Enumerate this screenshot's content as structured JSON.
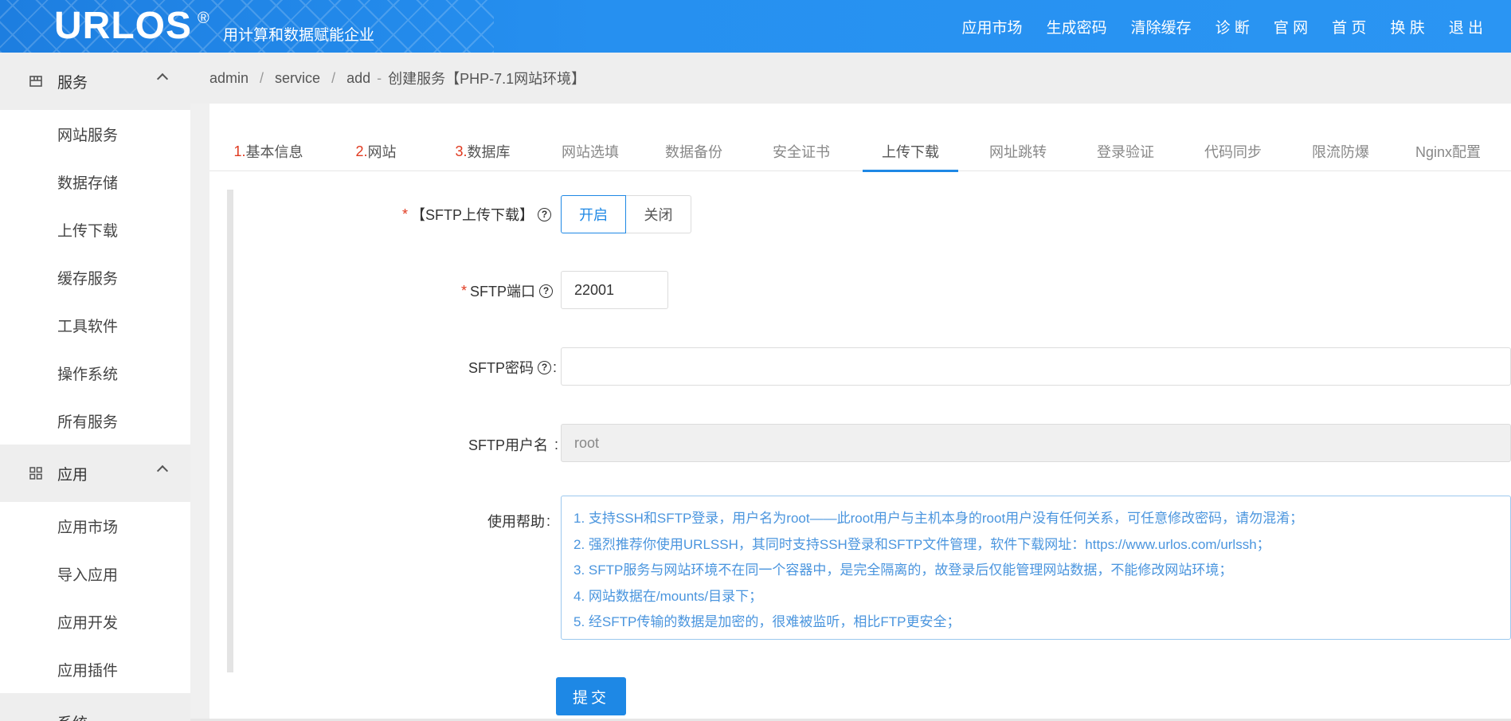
{
  "header": {
    "logo": "URLOS",
    "logo_mark": "®",
    "slogan": "用计算和数据赋能企业",
    "nav": [
      "应用市场",
      "生成密码",
      "清除缓存",
      "诊 断",
      "官 网",
      "首 页",
      "换 肤",
      "退 出"
    ]
  },
  "sidebar": {
    "groups": [
      {
        "label": "服务",
        "icon": "service-icon",
        "items": [
          "网站服务",
          "数据存储",
          "上传下载",
          "缓存服务",
          "工具软件",
          "操作系统",
          "所有服务"
        ]
      },
      {
        "label": "应用",
        "icon": "grid-icon",
        "items": [
          "应用市场",
          "导入应用",
          "应用开发",
          "应用插件"
        ]
      }
    ],
    "partial_group": "系统"
  },
  "breadcrumb": {
    "items": [
      "admin",
      "service",
      "add"
    ],
    "current": "创建服务【PHP-7.1网站环境】",
    "dash": "-"
  },
  "tabs": [
    {
      "num": "1.",
      "label": "基本信息"
    },
    {
      "num": "2.",
      "label": "网站"
    },
    {
      "num": "3.",
      "label": "数据库"
    },
    {
      "num": "",
      "label": "网站选填"
    },
    {
      "num": "",
      "label": "数据备份"
    },
    {
      "num": "",
      "label": "安全证书"
    },
    {
      "num": "",
      "label": "上传下载",
      "active": true
    },
    {
      "num": "",
      "label": "网址跳转"
    },
    {
      "num": "",
      "label": "登录验证"
    },
    {
      "num": "",
      "label": "代码同步"
    },
    {
      "num": "",
      "label": "限流防爆"
    },
    {
      "num": "",
      "label": "Nginx配置"
    }
  ],
  "form": {
    "sftp_toggle": {
      "label": "【SFTP上传下载】",
      "on": "开启",
      "off": "关闭",
      "selected": "开启"
    },
    "sftp_port": {
      "label": "SFTP端口",
      "value": "22001"
    },
    "sftp_password": {
      "label": "SFTP密码",
      "value": ""
    },
    "sftp_username": {
      "label": "SFTP用户名",
      "value": "root"
    },
    "help": {
      "label": "使用帮助",
      "lines": [
        "1. 支持SSH和SFTP登录，用户名为root——此root用户与主机本身的root用户没有任何关系，可任意修改密码，请勿混淆；",
        "2. 强烈推荐你使用URLSSH，其同时支持SSH登录和SFTP文件管理，软件下载网址：https://www.urlos.com/urlssh；",
        "3. SFTP服务与网站环境不在同一个容器中，是完全隔离的，故登录后仅能管理网站数据，不能修改网站环境；",
        "4. 网站数据在/mounts/目录下；",
        "5. 经SFTP传输的数据是加密的，很难被监听，相比FTP更安全；"
      ]
    },
    "submit": "提交"
  },
  "colors": {
    "accent": "#1e88e5",
    "required": "#e0391f",
    "help_text": "#4a95de"
  }
}
